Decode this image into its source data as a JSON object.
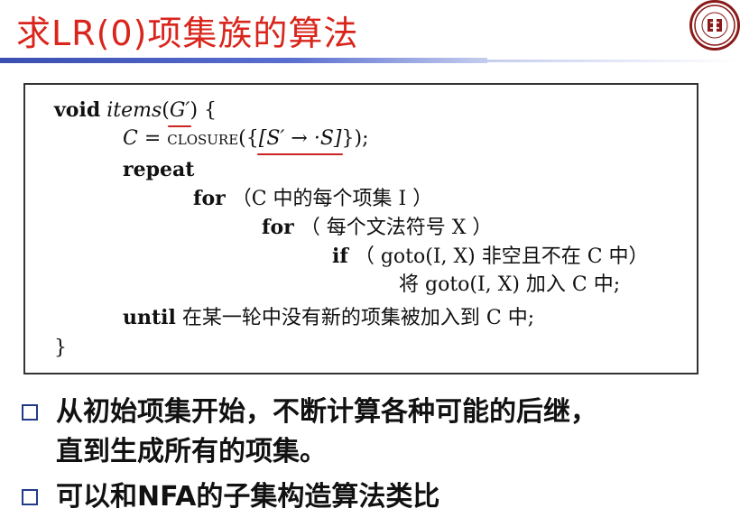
{
  "slide": {
    "title": "求LR(0)项集族的算法"
  },
  "algorithm": {
    "l1_kw": "void",
    "l1_fn": "items",
    "l1_open": "(",
    "l1_arg": "G′",
    "l1_close": ") {",
    "l2_var": "C",
    "l2_eq": " = ",
    "l2_fn": "closure",
    "l2_open": "({",
    "l2_item": "[S′ → ·S]",
    "l2_close": "});",
    "l3_kw": "repeat",
    "l4_kw": "for",
    "l4_text": "（C 中的每个项集 I ）",
    "l5_kw": "for",
    "l5_text": "（ 每个文法符号 X ）",
    "l6_kw": "if",
    "l6_text": "（ goto(I, X) 非空且不在 C 中）",
    "l7_text": "将 goto(I, X) 加入 C 中;",
    "l8_kw": "until",
    "l8_text": "在某一轮中没有新的项集被加入到 C 中;",
    "l9": "}"
  },
  "bullets": [
    {
      "text": "从初始项集开始，不断计算各种可能的后继，"
    },
    {
      "text": "直到生成所有的项集。"
    },
    {
      "text": "可以和NFA的子集构造算法类比"
    }
  ],
  "colors": {
    "title": "#d9251c",
    "bar": "#3a4fb0",
    "underline": "#cc2222",
    "bullet_box": "#223a8a"
  }
}
